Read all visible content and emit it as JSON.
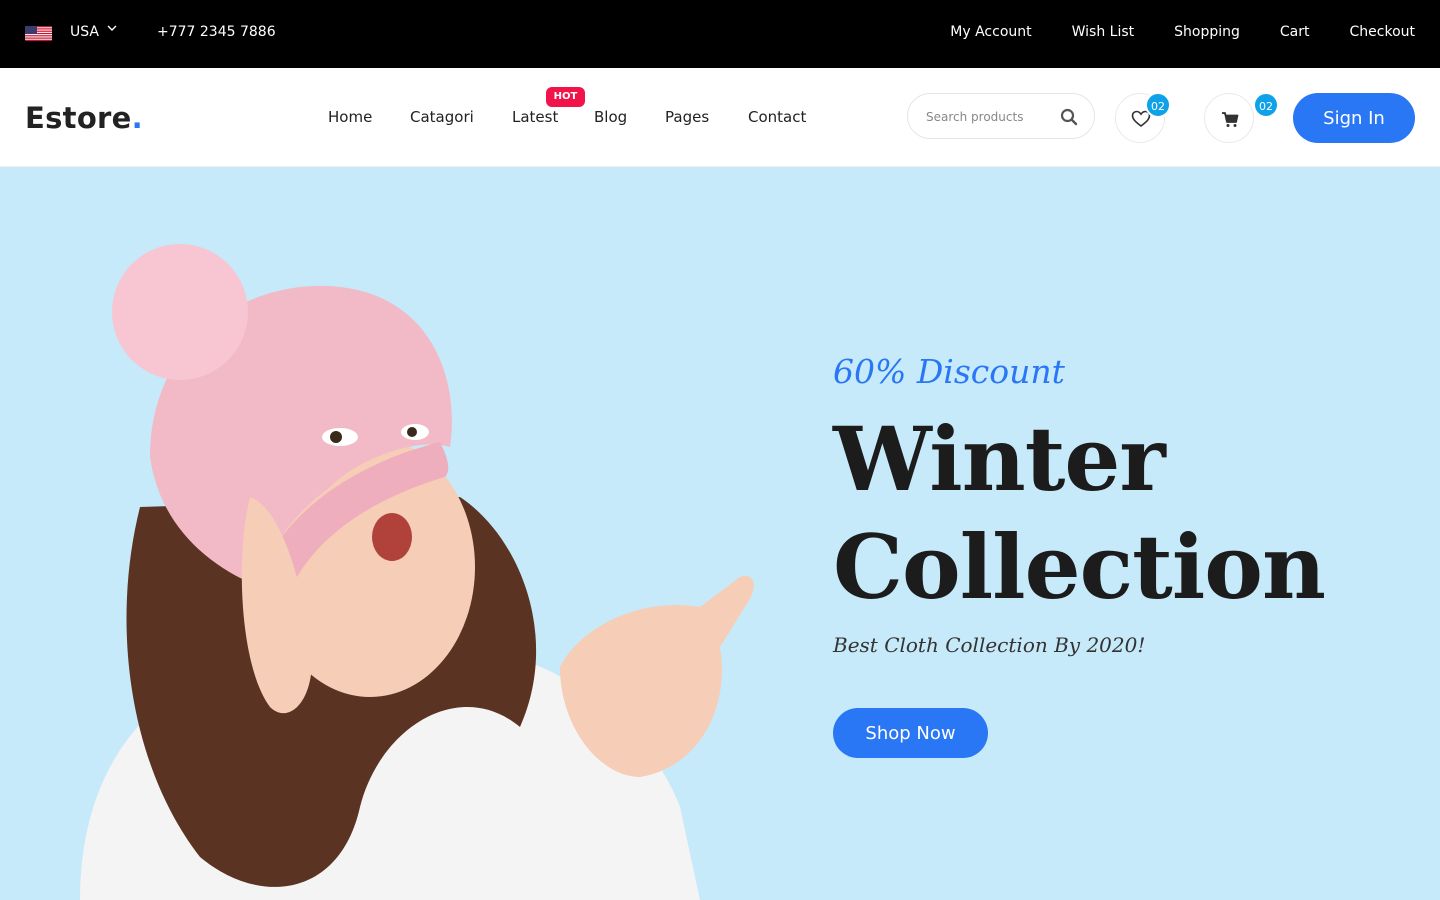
{
  "topbar": {
    "country": "USA",
    "phone": "+777 2345 7886",
    "links": [
      "My Account",
      "Wish List",
      "Shopping",
      "Cart",
      "Checkout"
    ]
  },
  "header": {
    "logo_text": "Estore",
    "logo_dot": ".",
    "nav": [
      "Home",
      "Catagori",
      "Latest",
      "Blog",
      "Pages",
      "Contact"
    ],
    "hot_badge": "HOT",
    "search_placeholder": "Search products",
    "wishlist_count": "02",
    "cart_count": "02",
    "signin_label": "Sign In"
  },
  "hero": {
    "discount": "60% Discount",
    "headline_line1": "Winter",
    "headline_line2": "Collection",
    "subline": "Best Cloth Collection By 2020!",
    "cta_label": "Shop Now"
  },
  "colors": {
    "accent": "#2977f5",
    "hot": "#f0144a",
    "badge": "#0fa2e8",
    "hero_bg": "#c6eafa",
    "topbar_bg": "#000000"
  },
  "icons": [
    "usa-flag-icon",
    "chevron-down-icon",
    "search-icon",
    "heart-icon",
    "cart-icon"
  ]
}
